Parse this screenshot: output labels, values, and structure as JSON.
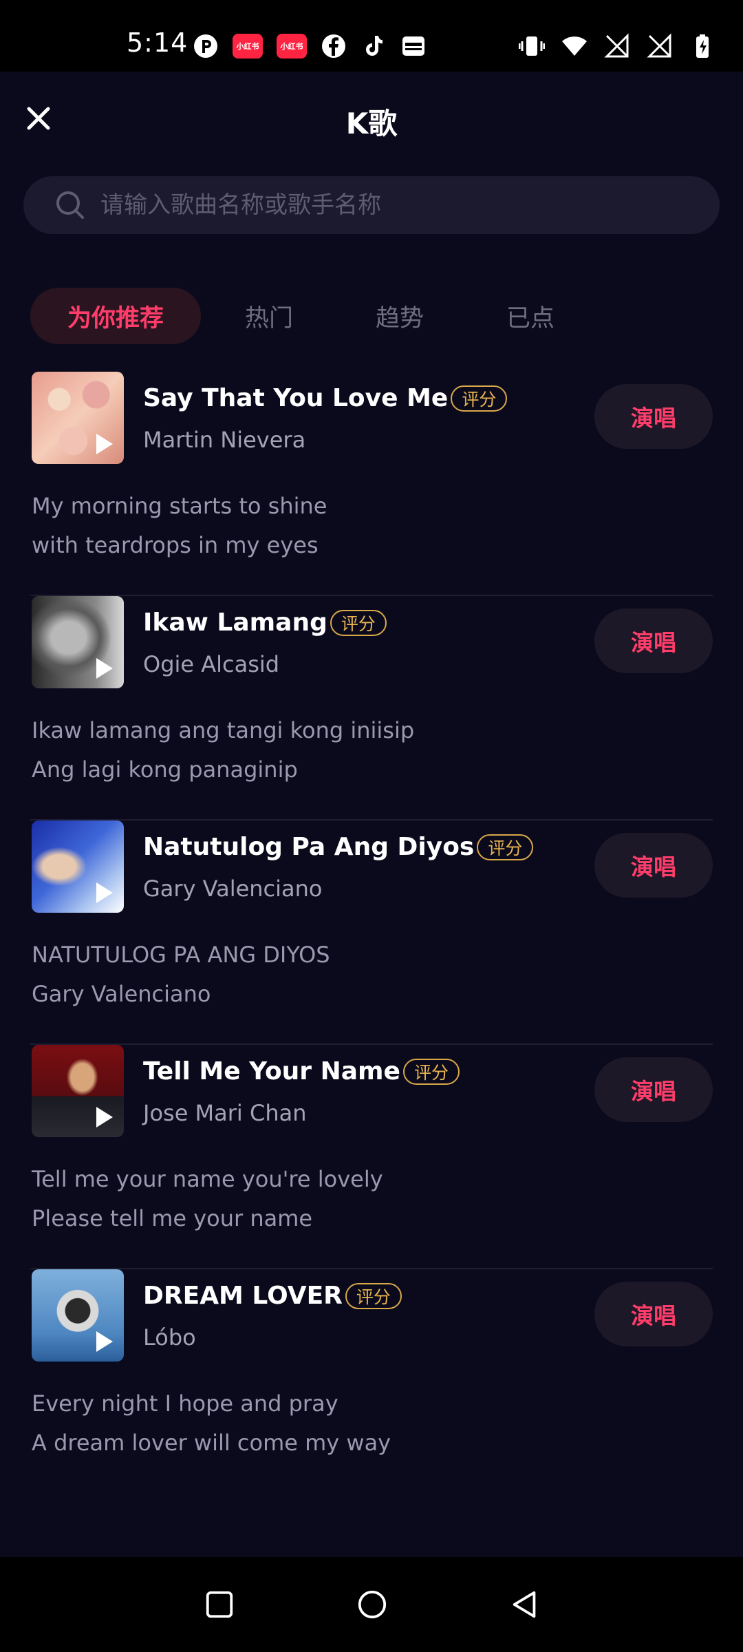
{
  "status_bar": {
    "time": "5:14",
    "notification_icons": [
      "p-icon",
      "xiaohongshu-icon",
      "xiaohongshu-icon",
      "facebook-icon",
      "tiktok-icon",
      "wallet-icon"
    ],
    "xhs_badge_text": "小红书",
    "system_icons": [
      "vibrate-icon",
      "wifi-icon",
      "signal-off-icon",
      "signal-off-icon",
      "battery-charging-icon"
    ]
  },
  "header": {
    "title": "K歌"
  },
  "search": {
    "placeholder": "请输入歌曲名称或歌手名称"
  },
  "tabs": [
    {
      "label": "为你推荐",
      "active": true
    },
    {
      "label": "热门",
      "active": false
    },
    {
      "label": "趋势",
      "active": false
    },
    {
      "label": "已点",
      "active": false
    }
  ],
  "colors": {
    "accent": "#ff3d6a",
    "background": "#0b0a1c",
    "score_badge": "#e6b44f"
  },
  "songs": [
    {
      "title": "Say That You Love Me",
      "artist": "Martin Nievera",
      "badge": "评分",
      "action": "演唱",
      "lyric_1": "My morning starts to shine",
      "lyric_2": "with teardrops in my eyes"
    },
    {
      "title": "Ikaw Lamang",
      "artist": "Ogie Alcasid",
      "badge": "评分",
      "action": "演唱",
      "lyric_1": "Ikaw lamang ang tangi kong iniisip",
      "lyric_2": "Ang lagi kong panaginip"
    },
    {
      "title": "Natutulog Pa Ang Diyos",
      "artist": "Gary Valenciano",
      "badge": "评分",
      "action": "演唱",
      "lyric_1": "NATUTULOG PA ANG DIYOS",
      "lyric_2": "Gary Valenciano"
    },
    {
      "title": "Tell Me Your Name",
      "artist": "Jose Mari Chan",
      "badge": "评分",
      "action": "演唱",
      "lyric_1": "Tell me your name you're lovely",
      "lyric_2": "Please tell me your name"
    },
    {
      "title": "DREAM LOVER",
      "artist": "Lóbo",
      "badge": "评分",
      "action": "演唱",
      "lyric_1": "Every night I hope and pray",
      "lyric_2": "A dream lover will come my way"
    }
  ],
  "nav_bar": {
    "buttons": [
      "recent-apps-icon",
      "home-icon",
      "back-icon"
    ]
  }
}
